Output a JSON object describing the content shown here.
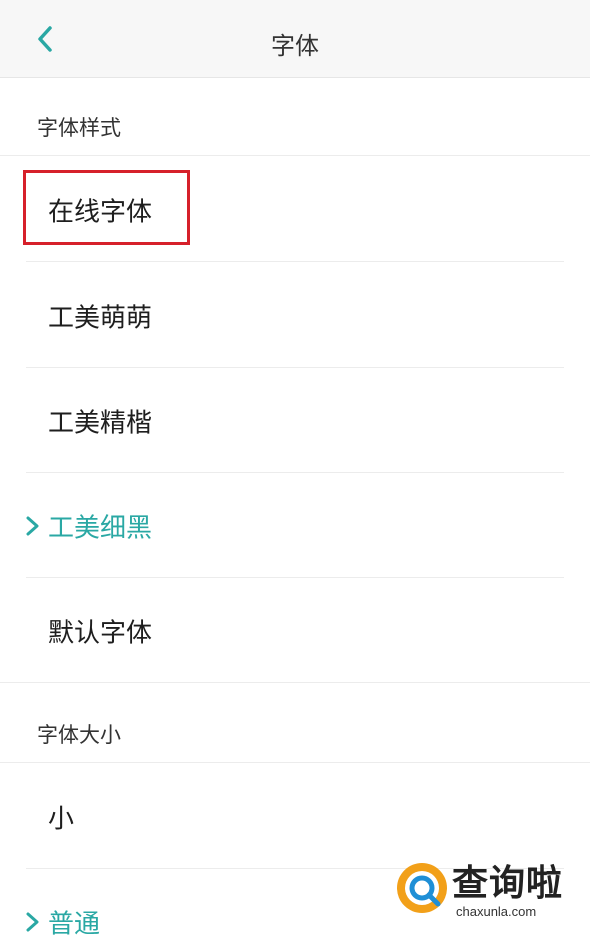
{
  "header": {
    "back_icon": "chevron-left-icon",
    "title": "字体"
  },
  "font_style": {
    "section_label": "字体样式",
    "items": [
      {
        "label": "在线字体",
        "selected": false,
        "highlighted": true
      },
      {
        "label": "工美萌萌",
        "selected": false
      },
      {
        "label": "工美精楷",
        "selected": false
      },
      {
        "label": "工美细黑",
        "selected": true
      },
      {
        "label": "默认字体",
        "selected": false
      }
    ]
  },
  "font_size": {
    "section_label": "字体大小",
    "items": [
      {
        "label": "小",
        "selected": false
      },
      {
        "label": "普通",
        "selected": true
      }
    ]
  },
  "colors": {
    "accent": "#2aa8a4",
    "highlight_border": "#d6202a",
    "topbar_bg": "#f7f7f7"
  },
  "watermark": {
    "text": "查询啦",
    "url": "chaxunla.com"
  }
}
